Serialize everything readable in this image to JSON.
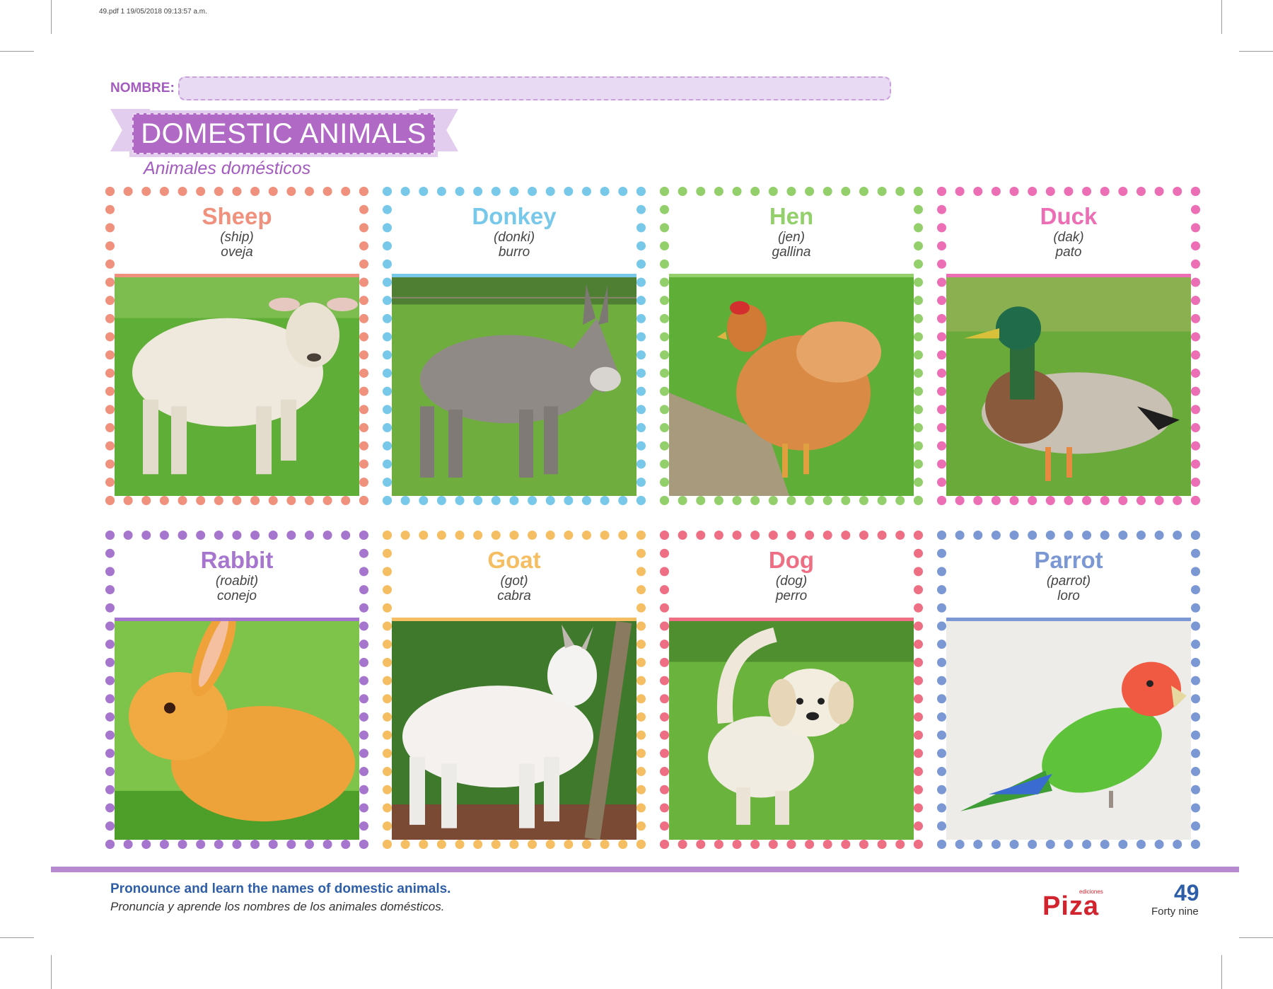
{
  "print_info": "49.pdf   1   19/05/2018   09:13:57 a.m.",
  "header": {
    "name_label": "NOMBRE:",
    "title": "DOMESTIC ANIMALS",
    "subtitle": "Animales domésticos"
  },
  "colors": {
    "purple": "#b06ac6",
    "title_text": "#ffffff",
    "instruction_blue": "#2f5ea8"
  },
  "cards": [
    {
      "name": "Sheep",
      "pron": "(ship)",
      "es": "oveja",
      "color": "#f0917e",
      "photo": "sheep-photo"
    },
    {
      "name": "Donkey",
      "pron": "(donki)",
      "es": "burro",
      "color": "#78c8ea",
      "photo": "donkey-photo"
    },
    {
      "name": "Hen",
      "pron": "(jen)",
      "es": "gallina",
      "color": "#93cf6b",
      "photo": "hen-photo"
    },
    {
      "name": "Duck",
      "pron": "(dak)",
      "es": "pato",
      "color": "#ec6eb4",
      "photo": "duck-photo"
    },
    {
      "name": "Rabbit",
      "pron": "(roabit)",
      "es": "conejo",
      "color": "#a676ce",
      "photo": "rabbit-photo"
    },
    {
      "name": "Goat",
      "pron": "(got)",
      "es": "cabra",
      "color": "#f5be62",
      "photo": "goat-photo"
    },
    {
      "name": "Dog",
      "pron": "(dog)",
      "es": "perro",
      "color": "#ee6f84",
      "photo": "dog-photo"
    },
    {
      "name": "Parrot",
      "pron": "(parrot)",
      "es": "loro",
      "color": "#7b98d4",
      "photo": "parrot-photo"
    }
  ],
  "footer": {
    "instruction_en": "Pronounce and learn the names of domestic animals.",
    "instruction_es": "Pronuncia y aprende los nombres de los animales domésticos.",
    "publisher_small": "ediciones",
    "publisher": "Piza",
    "page_number": "49",
    "page_words": "Forty nine"
  }
}
